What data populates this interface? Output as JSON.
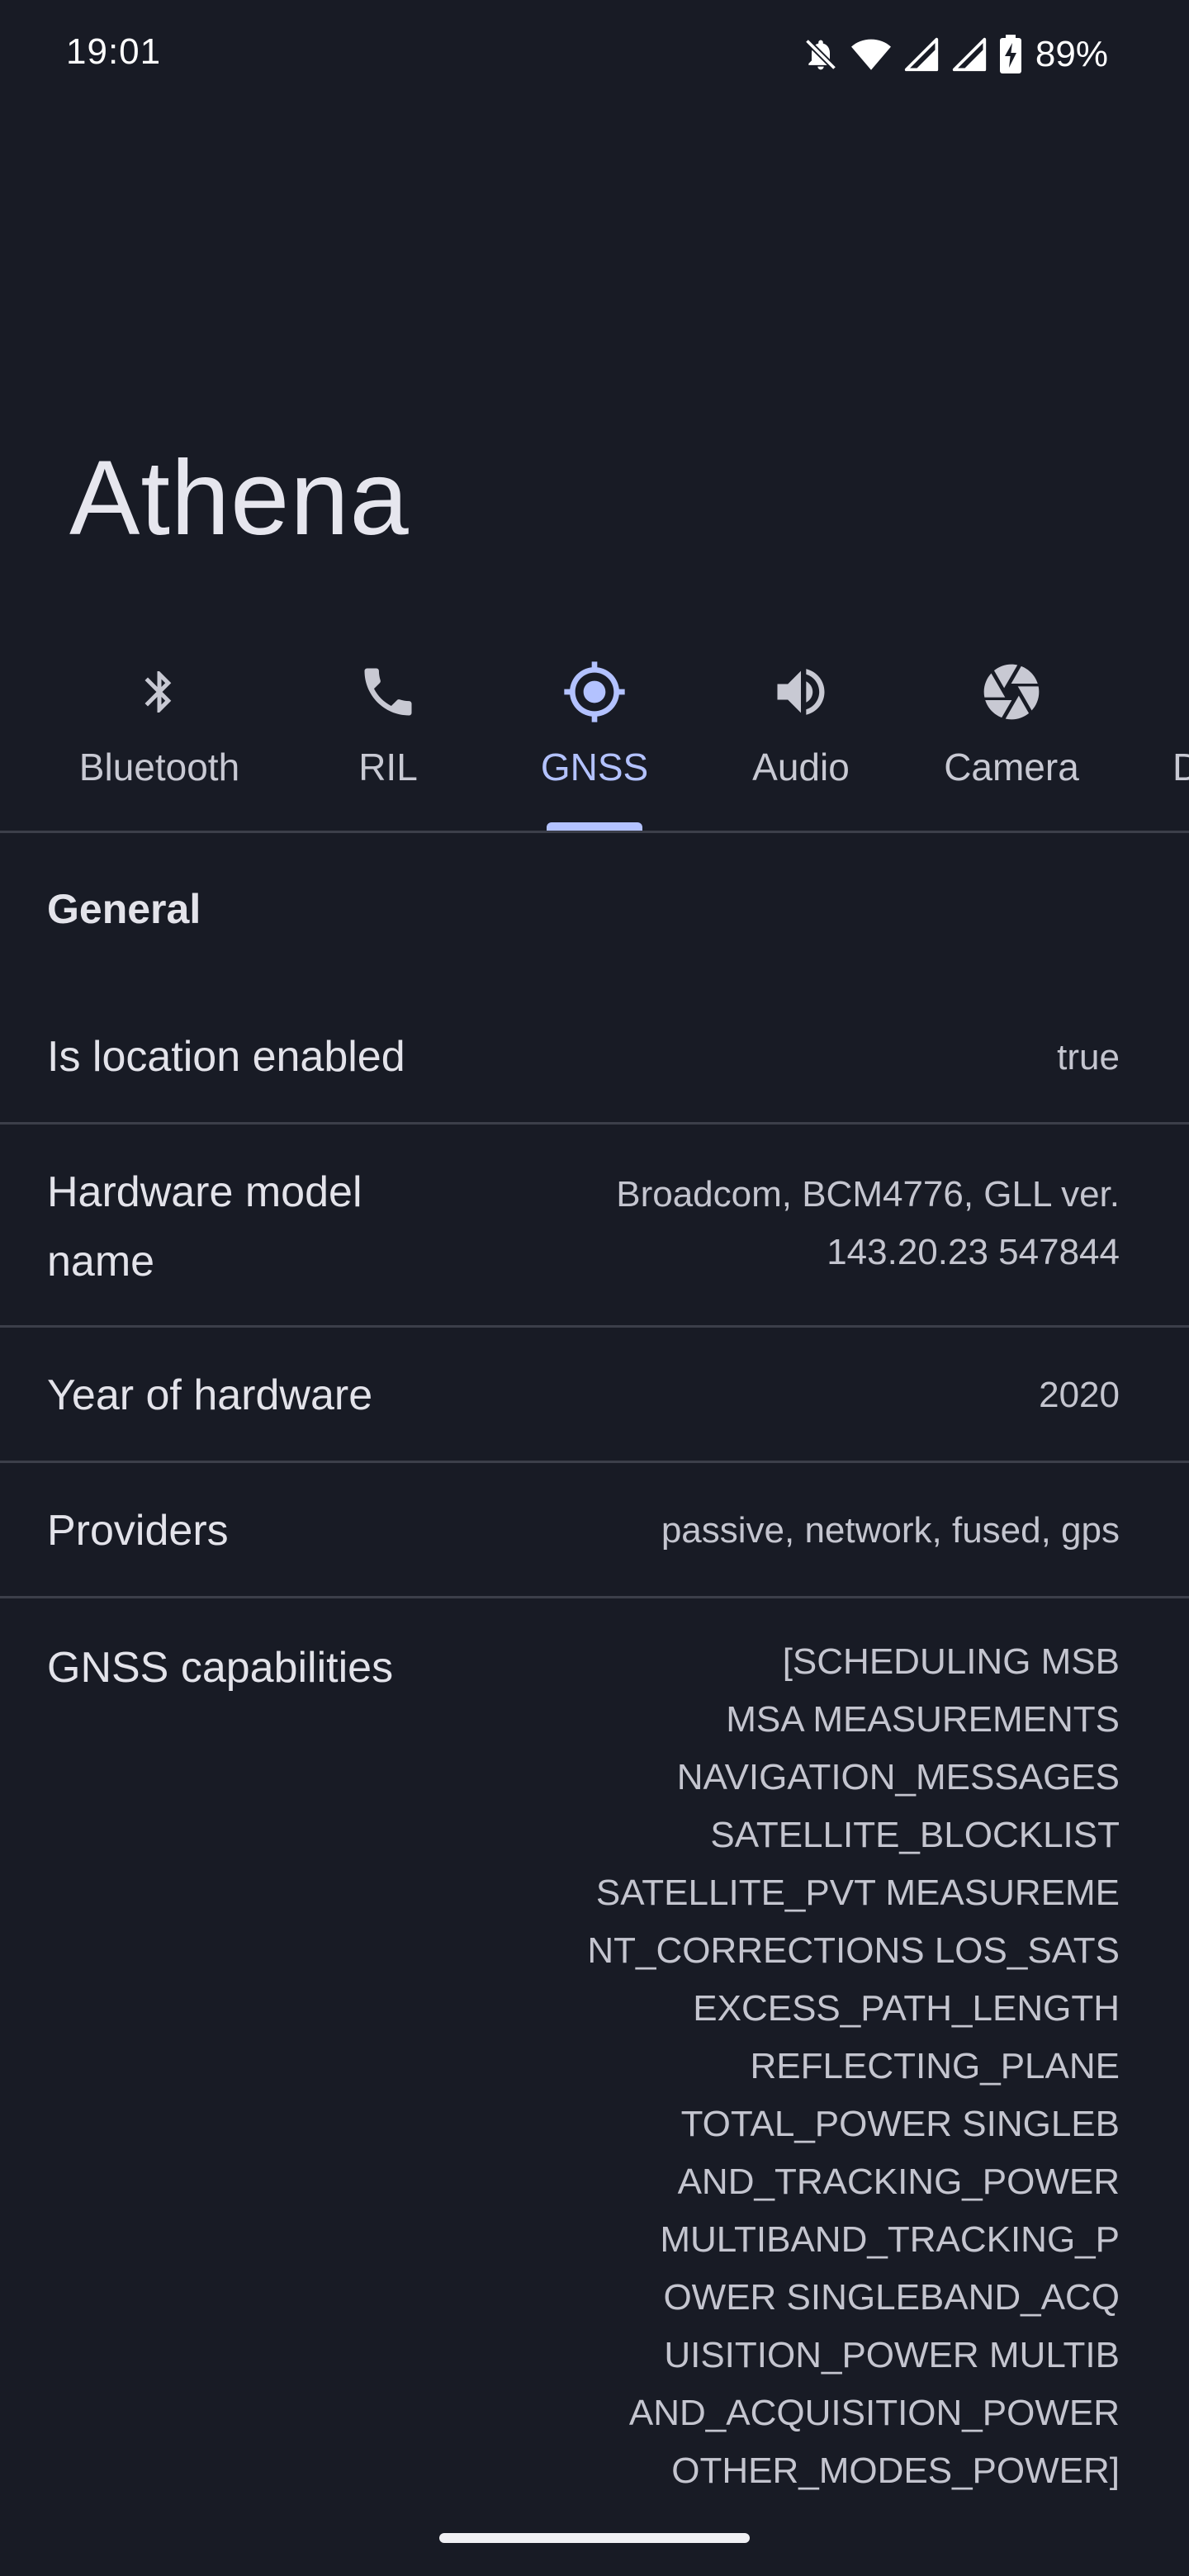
{
  "status_bar": {
    "time": "19:01",
    "battery_percent": "89%",
    "icons": [
      "bell-off-icon",
      "wifi-icon",
      "signal-icon",
      "signal-icon",
      "battery-charging-icon"
    ]
  },
  "title": "Athena",
  "tabs": [
    {
      "label": "Bluetooth",
      "icon": "bluetooth-icon",
      "active": false
    },
    {
      "label": "RIL",
      "icon": "phone-icon",
      "active": false
    },
    {
      "label": "GNSS",
      "icon": "gps-fixed-icon",
      "active": true
    },
    {
      "label": "Audio",
      "icon": "volume-icon",
      "active": false
    },
    {
      "label": "Camera",
      "icon": "camera-aperture-icon",
      "active": false
    },
    {
      "label": "D",
      "icon": "",
      "active": false
    }
  ],
  "section": {
    "header": "General",
    "rows": [
      {
        "label": "Is location enabled",
        "value": "true"
      },
      {
        "label": "Hardware model\nname",
        "value": "Broadcom, BCM4776, GLL ver.\n143.20.23 547844"
      },
      {
        "label": "Year of hardware",
        "value": "2020"
      },
      {
        "label": "Providers",
        "value": "passive, network, fused, gps"
      },
      {
        "label": "GNSS capabilities",
        "value": "[SCHEDULING MSB\nMSA MEASUREMENTS\nNAVIGATION_MESSAGES\nSATELLITE_BLOCKLIST\nSATELLITE_PVT MEASUREME\nNT_CORRECTIONS LOS_SATS\nEXCESS_PATH_LENGTH\nREFLECTING_PLANE\nTOTAL_POWER SINGLEB\nAND_TRACKING_POWER\nMULTIBAND_TRACKING_P\nOWER SINGLEBAND_ACQ\nUISITION_POWER MULTIB\nAND_ACQUISITION_POWER\nOTHER_MODES_POWER]"
      }
    ]
  },
  "colors": {
    "background": "#181b25",
    "accent": "#b3c2ff",
    "divider": "#3c3f4a"
  }
}
